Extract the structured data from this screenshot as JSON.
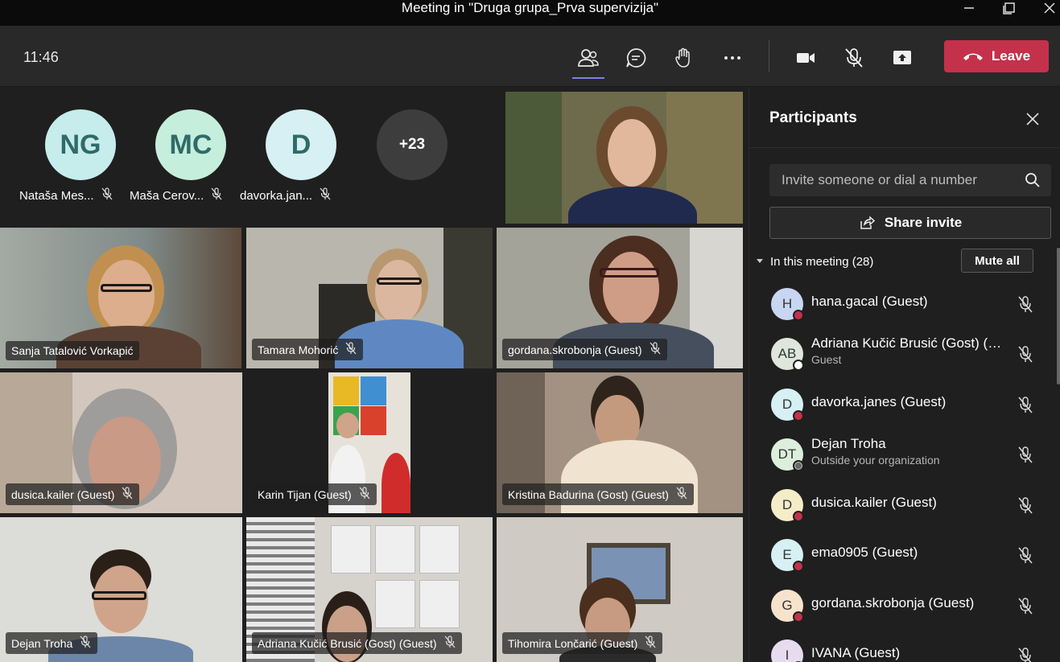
{
  "window": {
    "title": "Meeting in \"Druga grupa_Prva supervizija\""
  },
  "toolbar": {
    "time": "11:46",
    "leave_label": "Leave"
  },
  "avatar_strip": [
    {
      "initials": "NG",
      "name": "Nataša Mes...",
      "color": "#c7ecec"
    },
    {
      "initials": "MC",
      "name": "Maša Cerov...",
      "color": "#c6eedd"
    },
    {
      "initials": "D",
      "name": "davorka.jan...",
      "color": "#d6f0f3"
    }
  ],
  "overflow_count": "+23",
  "tiles": [
    {
      "name": "Sanja Tatalović Vorkapić",
      "muted": false
    },
    {
      "name": "Tamara Mohorić",
      "muted": true
    },
    {
      "name": "gordana.skrobonja (Guest)",
      "muted": true
    },
    {
      "name": "dusica.kailer (Guest)",
      "muted": true
    },
    {
      "name": "Karin Tijan (Guest)",
      "muted": true
    },
    {
      "name": "Kristina Badurina (Gost) (Guest)",
      "muted": true
    },
    {
      "name": "Dejan Troha",
      "muted": true
    },
    {
      "name": "Adriana Kučić Brusić (Gost) (Guest)",
      "muted": true
    },
    {
      "name": "Tihomira Lončarić (Guest)",
      "muted": true
    }
  ],
  "panel": {
    "title": "Participants",
    "invite_placeholder": "Invite someone or dial a number",
    "share_invite_label": "Share invite",
    "section_label": "In this meeting (28)",
    "mute_all_label": "Mute all",
    "participants": [
      {
        "initials": "H",
        "name": "hana.gacal (Guest)",
        "sub": "",
        "avatar_color": "#c8d6f2",
        "status": "busy"
      },
      {
        "initials": "AB",
        "name": "Adriana Kučić Brusić (Gost) (G...",
        "sub": "Guest",
        "avatar_color": "#dfe6dc",
        "status": "offline"
      },
      {
        "initials": "D",
        "name": "davorka.janes (Guest)",
        "sub": "",
        "avatar_color": "#d6f0f3",
        "status": "busy"
      },
      {
        "initials": "DT",
        "name": "Dejan Troha",
        "sub": "Outside your organization",
        "avatar_color": "#dcefdc",
        "status": "external"
      },
      {
        "initials": "D",
        "name": "dusica.kailer (Guest)",
        "sub": "",
        "avatar_color": "#f5ecc8",
        "status": "busy"
      },
      {
        "initials": "E",
        "name": "ema0905 (Guest)",
        "sub": "",
        "avatar_color": "#d6f0f3",
        "status": "busy"
      },
      {
        "initials": "G",
        "name": "gordana.skrobonja (Guest)",
        "sub": "",
        "avatar_color": "#f7e3cc",
        "status": "busy"
      },
      {
        "initials": "I",
        "name": "IVANA (Guest)",
        "sub": "",
        "avatar_color": "#e7dcef",
        "status": "busy"
      }
    ]
  },
  "colors": {
    "accent": "#7b83eb",
    "leave": "#c4314b",
    "busy": "#c4314b"
  }
}
